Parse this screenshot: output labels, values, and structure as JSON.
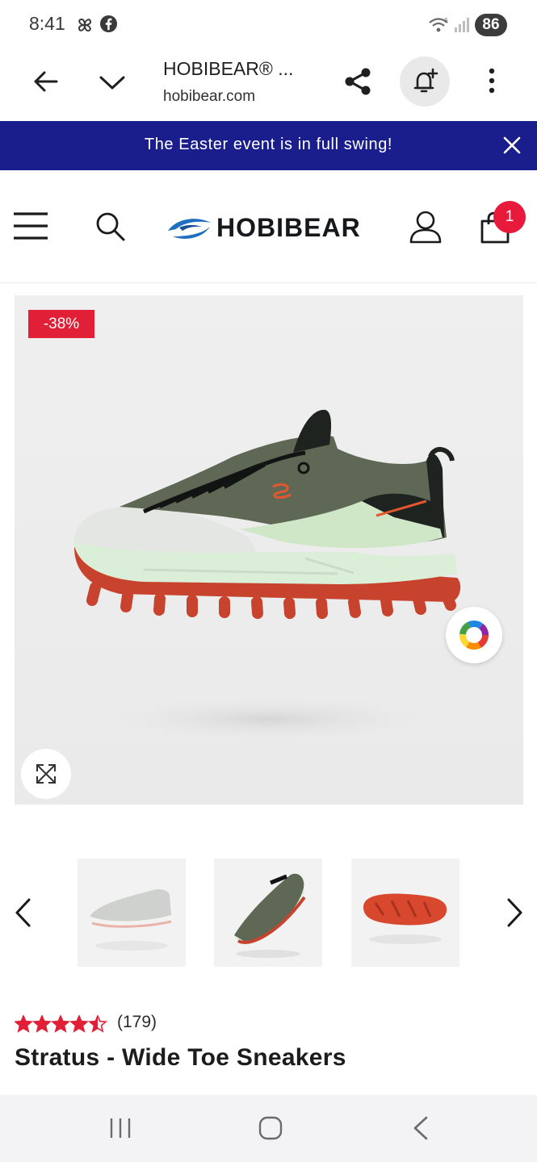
{
  "status_bar": {
    "time": "8:41",
    "battery": "86"
  },
  "browser": {
    "site_title": "HOBIBEAR® ...",
    "url": "hobibear.com"
  },
  "announcement": {
    "text": "The Easter event is in full swing!"
  },
  "header": {
    "brand": "HOBIBEAR",
    "cart_count": "1"
  },
  "product": {
    "discount_badge": "-38%",
    "rating": 4.5,
    "rating_max": 5,
    "rating_count": "(179)",
    "title": "Stratus - Wide Toe Sneakers"
  },
  "colors": {
    "announcement_bg": "#1a1d8c",
    "accent_red": "#e11f36",
    "brand_blue": "#1e6fc0"
  }
}
